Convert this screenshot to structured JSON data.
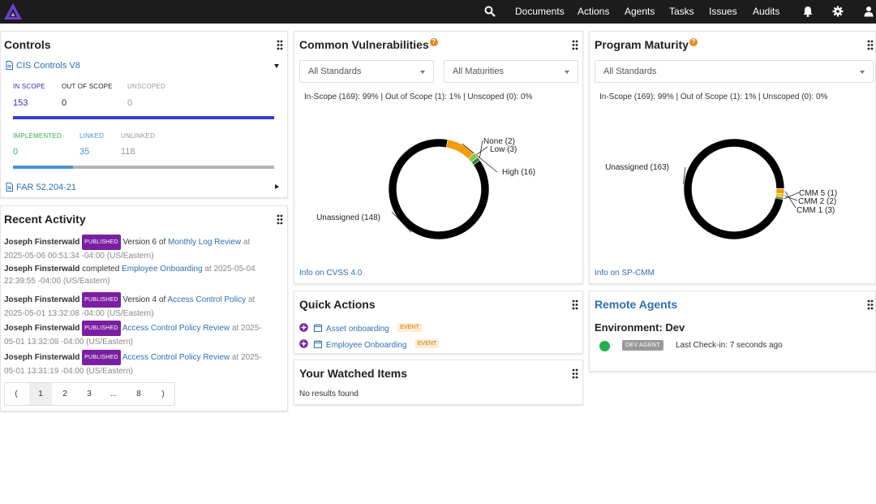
{
  "nav": {
    "items": [
      "Documents",
      "Actions",
      "Agents",
      "Tasks",
      "Issues",
      "Audits"
    ]
  },
  "controls": {
    "title": "Controls",
    "framework1": "CIS Controls V8",
    "scope": {
      "in_label": "IN SCOPE",
      "in_value": "153",
      "out_label": "OUT OF SCOPE",
      "out_value": "0",
      "unscoped_label": "UNSCOPED",
      "unscoped_value": "0"
    },
    "impl": {
      "implemented_label": "IMPLEMENTED",
      "implemented_value": "0",
      "linked_label": "LINKED",
      "linked_value": "35",
      "unlinked_label": "UNLINKED",
      "unlinked_value": "118"
    },
    "framework2": "FAR 52.204-21"
  },
  "recent": {
    "title": "Recent Activity",
    "published": "PUBLISHED",
    "entries": [
      {
        "user": "Joseph Finsterwald",
        "pre": "Version 6 of",
        "link": "Monthly Log Review",
        "at": "at",
        "ts1": "2025-05-06 00:51:34 -04:00 (US/Eastern)"
      },
      {
        "user": "Joseph Finsterwald",
        "pre": "completed",
        "link": "Employee Onboarding",
        "at": "at 2025-05-04",
        "ts1": "22:39:55 -04:00 (US/Eastern)"
      },
      {
        "user": "Joseph Finsterwald",
        "pre": "Version 4 of",
        "link": "Access Control Policy",
        "at": "at",
        "ts1": "2025-05-01 13:32:08 -04:00 (US/Eastern)"
      },
      {
        "user": "Joseph Finsterwald",
        "pre": "",
        "link": "Access Control Policy Review",
        "at": "at 2025-",
        "ts1": "05-01 13:32:08 -04:00 (US/Eastern)"
      },
      {
        "user": "Joseph Finsterwald",
        "pre": "",
        "link": "Access Control Policy Review",
        "at": "at 2025-",
        "ts1": "05-01 13:31:19 -04:00 (US/Eastern)"
      }
    ],
    "pager": [
      "(",
      "1",
      "2",
      "3",
      "...",
      "8",
      ")"
    ]
  },
  "vuln": {
    "title": "Common Vulnerabilities",
    "help": "?",
    "select1": "All Standards",
    "select2": "All Maturities",
    "summary": "In-Scope (169): 99% | Out of Scope (1): 1% | Unscoped (0): 0%",
    "link": "Info on CVSS 4.0"
  },
  "maturity": {
    "title": "Program Maturity",
    "help": "?",
    "select1": "All Standards",
    "summary": "In-Scope (169): 99% | Out of Scope (1): 1% | Unscoped (0): 0%",
    "link": "Info on SP-CMM"
  },
  "quick": {
    "title": "Quick Actions",
    "items": [
      {
        "label": "Asset onboarding",
        "tag": "EVENT"
      },
      {
        "label": "Employee Onboarding",
        "tag": "EVENT"
      }
    ]
  },
  "watched": {
    "title": "Your Watched Items",
    "empty": "No results found"
  },
  "agents": {
    "title": "Remote Agents",
    "env": "Environment: Dev",
    "badge": "DEV AGENT",
    "checkin": "Last Check-in: 7 seconds ago",
    "status_color": "#22b14c"
  },
  "chart_data": [
    {
      "type": "pie",
      "title": "Common Vulnerabilities",
      "slices": [
        {
          "label": "Unassigned (148)",
          "value": 148,
          "color": "#000000"
        },
        {
          "label": "High (16)",
          "value": 16,
          "color": "#f39c12"
        },
        {
          "label": "Low (3)",
          "value": 3,
          "color": "#8bc34a"
        },
        {
          "label": "None (2)",
          "value": 2,
          "color": "#2e7d32"
        }
      ]
    },
    {
      "type": "pie",
      "title": "Program Maturity",
      "slices": [
        {
          "label": "Unassigned (163)",
          "value": 163,
          "color": "#000000"
        },
        {
          "label": "CMM 1 (3)",
          "value": 3,
          "color": "#f39c12"
        },
        {
          "label": "CMM 2 (2)",
          "value": 2,
          "color": "#f1c40f"
        },
        {
          "label": "CMM 5 (1)",
          "value": 1,
          "color": "#2e7d32"
        }
      ]
    }
  ]
}
